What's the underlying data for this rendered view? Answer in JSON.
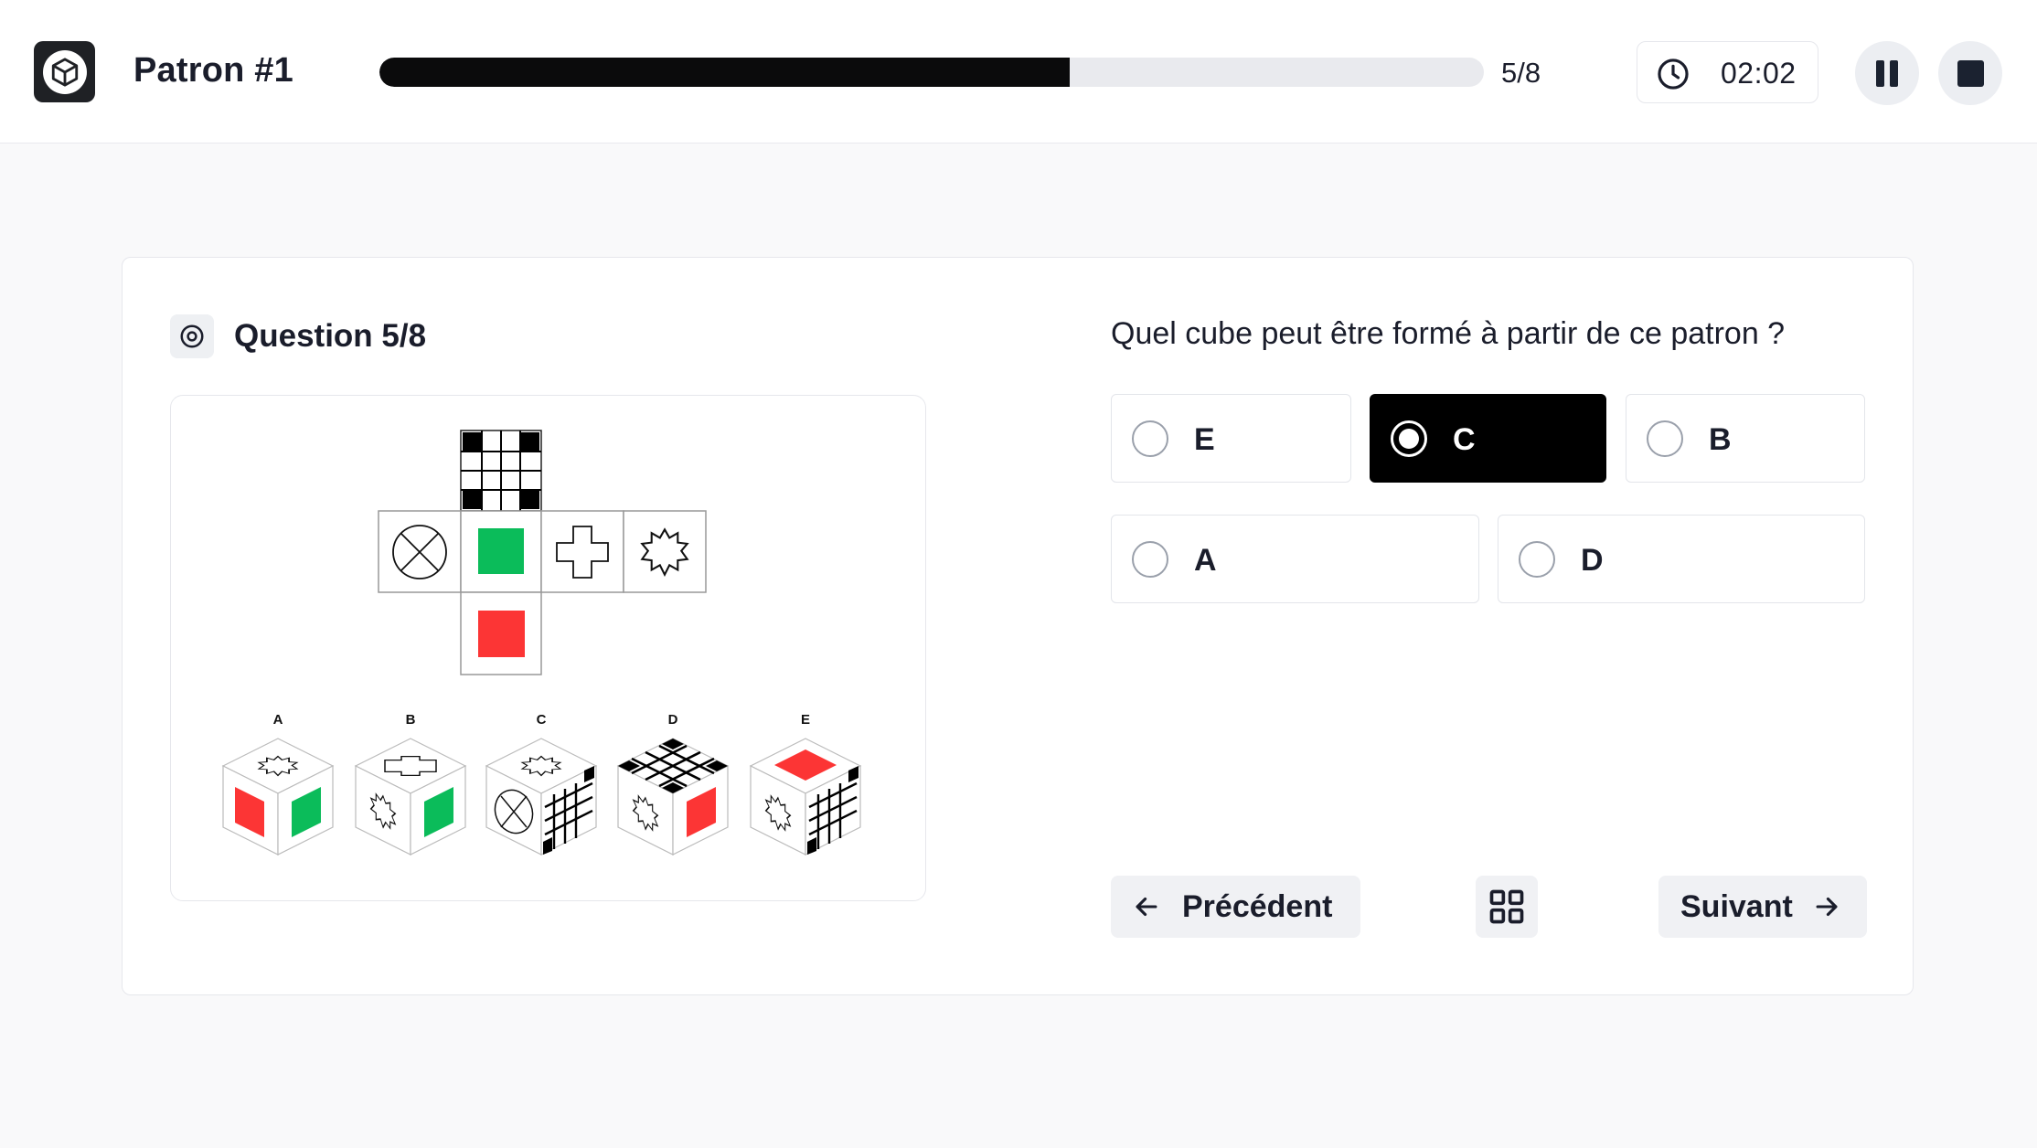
{
  "header": {
    "title": "Patron #1",
    "progress_label": "5/8",
    "progress_fraction": 0.625,
    "timer": "02:02"
  },
  "question": {
    "title": "Question 5/8",
    "prompt": "Quel cube peut être formé à partir de ce patron ?",
    "cube_labels": [
      "A",
      "B",
      "C",
      "D",
      "E"
    ],
    "face_colors": {
      "green": "#0bbc5a",
      "red": "#fc3535"
    }
  },
  "options": [
    {
      "label": "E",
      "selected": false
    },
    {
      "label": "C",
      "selected": true
    },
    {
      "label": "B",
      "selected": false
    },
    {
      "label": "A",
      "selected": false
    },
    {
      "label": "D",
      "selected": false
    }
  ],
  "nav": {
    "prev_label": "Précédent",
    "next_label": "Suivant"
  }
}
